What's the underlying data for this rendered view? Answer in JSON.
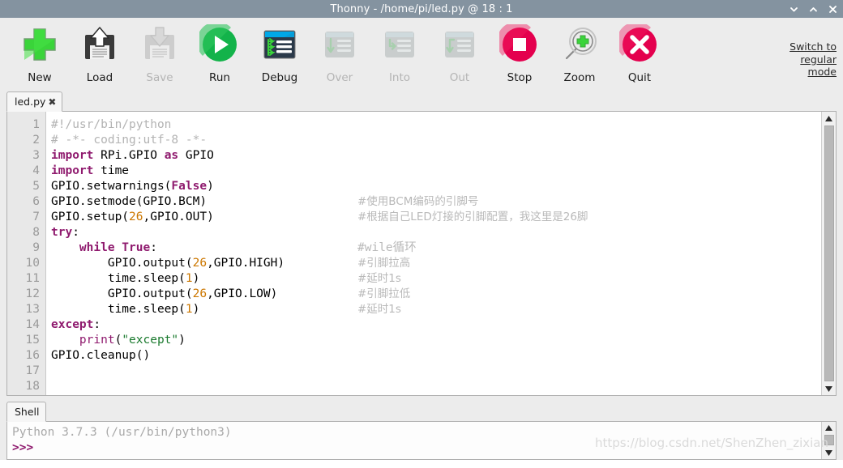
{
  "window": {
    "title": "Thonny  -  /home/pi/led.py @ 18 : 1",
    "buttons": [
      {
        "name": "minimize",
        "glyph": "chevron-down"
      },
      {
        "name": "maximize",
        "glyph": "chevron-up"
      },
      {
        "name": "close",
        "glyph": "x"
      }
    ]
  },
  "toolbar": {
    "items": [
      {
        "label": "New",
        "icon": "plus-icon",
        "enabled": true
      },
      {
        "label": "Load",
        "icon": "floppy-up-icon",
        "enabled": true
      },
      {
        "label": "Save",
        "icon": "floppy-down-icon",
        "enabled": false
      },
      {
        "label": "Run",
        "icon": "play-icon",
        "enabled": true
      },
      {
        "label": "Debug",
        "icon": "debug-icon",
        "enabled": true
      },
      {
        "label": "Over",
        "icon": "step-over-icon",
        "enabled": false
      },
      {
        "label": "Into",
        "icon": "step-into-icon",
        "enabled": false
      },
      {
        "label": "Out",
        "icon": "step-out-icon",
        "enabled": false
      },
      {
        "label": "Stop",
        "icon": "stop-icon",
        "enabled": true
      },
      {
        "label": "Zoom",
        "icon": "magnifier-plus-icon",
        "enabled": true
      },
      {
        "label": "Quit",
        "icon": "x-circle-icon",
        "enabled": true
      }
    ],
    "mode_link": {
      "line1": "Switch to",
      "line2": "regular",
      "line3": "mode"
    }
  },
  "editor": {
    "tab": {
      "label": "led.py",
      "close_glyph": "✖"
    },
    "line_numbers": [
      "1",
      "2",
      "3",
      "4",
      "5",
      "6",
      "7",
      "8",
      "9",
      "10",
      "11",
      "12",
      "13",
      "14",
      "15",
      "16",
      "17",
      "18"
    ],
    "lines": [
      {
        "n": 1,
        "code": "#!/usr/bin/python",
        "comment": ""
      },
      {
        "n": 2,
        "code": "# -*- coding:utf-8 -*-",
        "comment": ""
      },
      {
        "n": 3,
        "code": "import RPi.GPIO as GPIO",
        "comment": ""
      },
      {
        "n": 4,
        "code": "import time",
        "comment": ""
      },
      {
        "n": 5,
        "code": "GPIO.setwarnings(False)",
        "comment": ""
      },
      {
        "n": 6,
        "code": "GPIO.setmode(GPIO.BCM)",
        "comment": "#使用BCM编码的引脚号"
      },
      {
        "n": 7,
        "code": "GPIO.setup(26,GPIO.OUT)",
        "comment": "#根据自己LED灯接的引脚配置，我这里是26脚"
      },
      {
        "n": 8,
        "code": "try:",
        "comment": ""
      },
      {
        "n": 9,
        "code": "    while True:",
        "comment": "#wile循环"
      },
      {
        "n": 10,
        "code": "        GPIO.output(26,GPIO.HIGH)",
        "comment": "#引脚拉高"
      },
      {
        "n": 11,
        "code": "        time.sleep(1)",
        "comment": "#延时1s"
      },
      {
        "n": 12,
        "code": "        GPIO.output(26,GPIO.LOW)",
        "comment": "#引脚拉低"
      },
      {
        "n": 13,
        "code": "        time.sleep(1)",
        "comment": "#延时1s"
      },
      {
        "n": 14,
        "code": "except:",
        "comment": ""
      },
      {
        "n": 15,
        "code": "    print(\"except\")",
        "comment": ""
      },
      {
        "n": 16,
        "code": "GPIO.cleanup()",
        "comment": ""
      },
      {
        "n": 17,
        "code": "",
        "comment": ""
      },
      {
        "n": 18,
        "code": "",
        "comment": ""
      }
    ]
  },
  "shell": {
    "tab_label": "Shell",
    "info_line": "Python 3.7.3 (/usr/bin/python3)",
    "prompt": ">>>"
  },
  "watermark": "https://blog.csdn.net/ShenZhen_zixian",
  "colors": {
    "titlebar": "#8493a0",
    "toolbar_bg": "#ececec",
    "accent_green": "#3ad43a",
    "accent_red": "#e4004e",
    "keyword": "#8f1a6e",
    "comment": "#b3b3b3",
    "number": "#cc7700",
    "string": "#1a7a2e"
  }
}
